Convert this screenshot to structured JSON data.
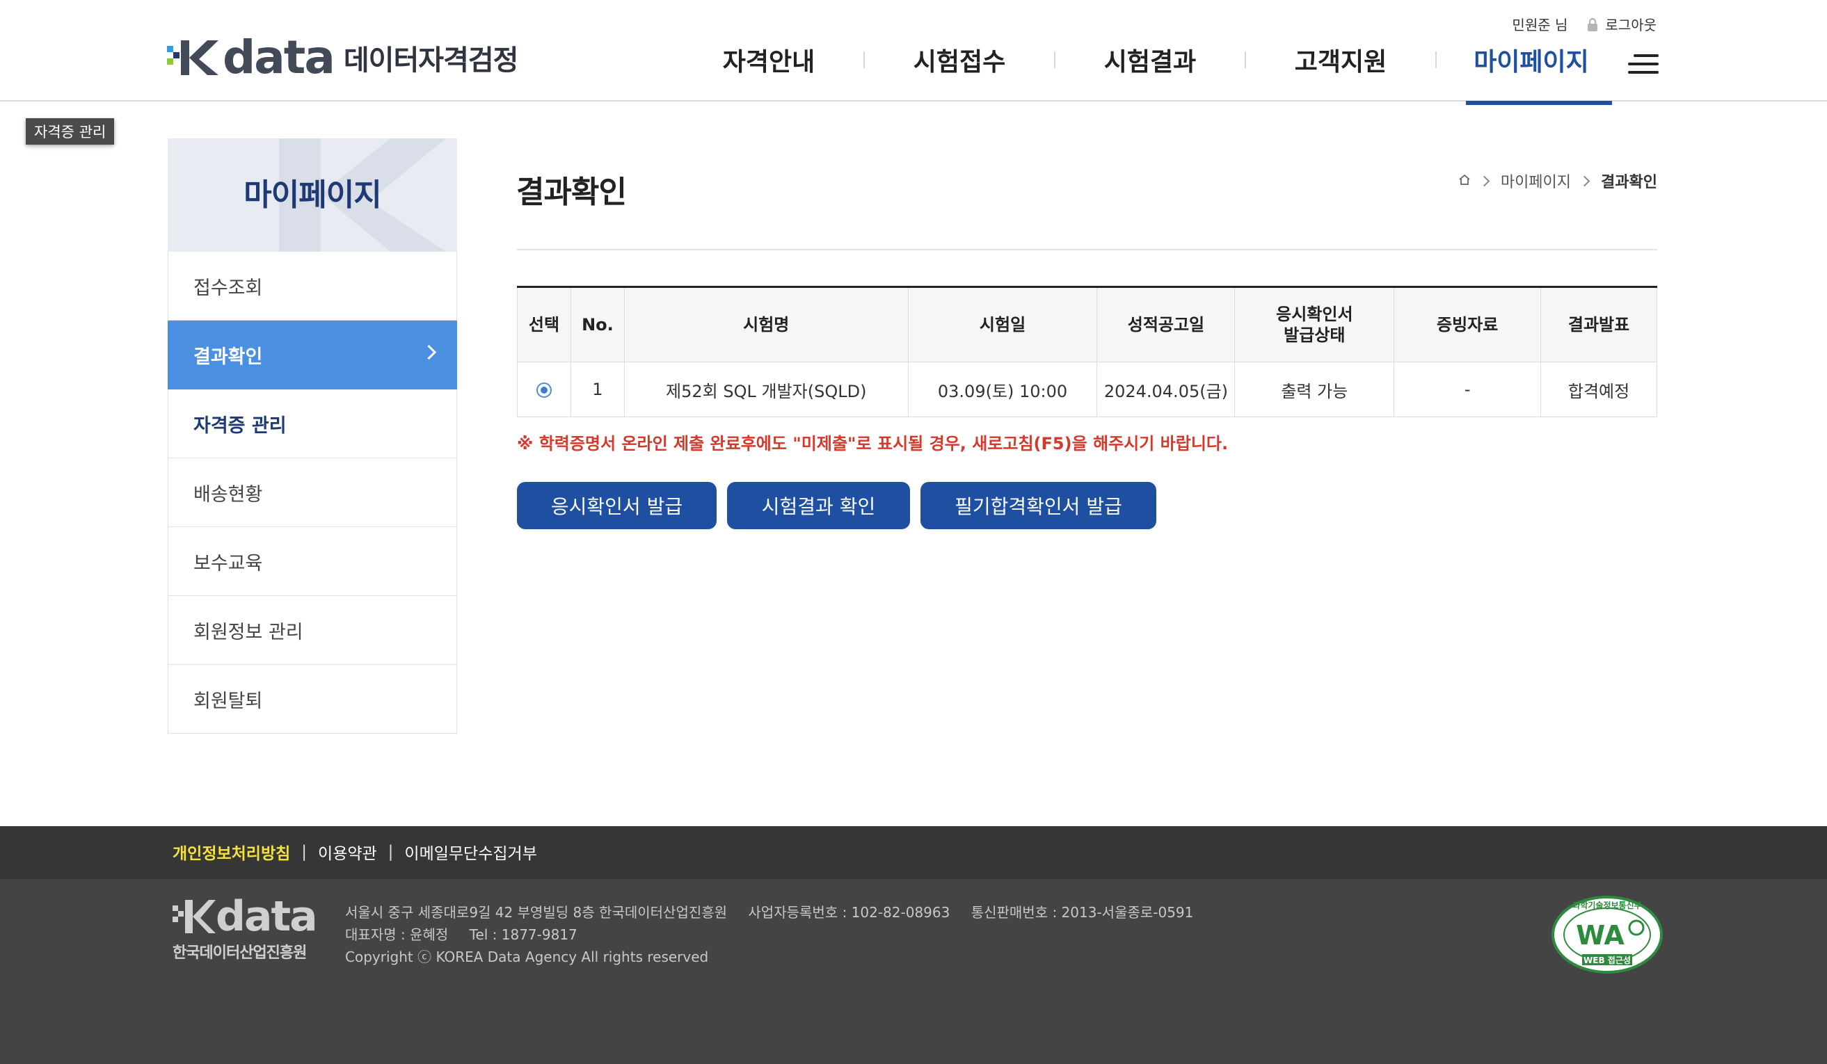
{
  "header": {
    "logo_word": "data",
    "logo_kr": "데이터자격검정",
    "user_name": "민원준 님",
    "logout": "로그아웃",
    "nav": [
      "자격안내",
      "시험접수",
      "시험결과",
      "고객지원",
      "마이페이지"
    ]
  },
  "tooltip": "자격증 관리",
  "sidebar": {
    "title": "마이페이지",
    "items": [
      {
        "label": "접수조회"
      },
      {
        "label": "결과확인"
      },
      {
        "label": "자격증 관리"
      },
      {
        "label": "배송현황"
      },
      {
        "label": "보수교육"
      },
      {
        "label": "회원정보 관리"
      },
      {
        "label": "회원탈퇴"
      }
    ]
  },
  "content": {
    "title": "결과확인",
    "breadcrumb": [
      "마이페이지",
      "결과확인"
    ],
    "table": {
      "headers": [
        "선택",
        "No.",
        "시험명",
        "시험일",
        "성적공고일",
        "응시확인서",
        "발급상태",
        "증빙자료",
        "결과발표"
      ],
      "row": {
        "no": "1",
        "exam": "제52회 SQL 개발자(SQLD)",
        "date": "03.09(토) 10:00",
        "notice_date": "2024.04.05(금)",
        "status": "출력 가능",
        "evidence": "-",
        "result": "합격예정"
      }
    },
    "notice": "※ 학력증명서 온라인 제출 완료후에도 \"미제출\"로 표시될 경우, 새로고침(F5)을 해주시기 바랍니다.",
    "buttons": [
      "응시확인서 발급",
      "시험결과 확인",
      "필기합격확인서 발급"
    ]
  },
  "footer": {
    "links": [
      "개인정보처리방침",
      "이용약관",
      "이메일무단수집거부"
    ],
    "logo_word": "data",
    "logo_kr": "한국데이터산업진흥원",
    "address": "서울시 중구 세종대로9길 42 부영빌딩 8층 한국데이터산업진흥원",
    "biz_no": "사업자등록번호 : 102-82-08963",
    "sales_no": "통신판매번호 : 2013-서울종로-0591",
    "ceo": "대표자명 : 윤혜정",
    "tel": "Tel : 1877-9817",
    "copyright": "Copyright ⓒ KOREA Data Agency All rights reserved",
    "wa_top": "과학기술정보통신부",
    "wa_mid": "WA",
    "wa_bottom": "WEB 접근성"
  },
  "colors": {
    "primary": "#1f4fa0",
    "sidebar_active": "#4a8fe0",
    "notice_red": "#d33a2c",
    "footer_link_yellow": "#f5e23b"
  }
}
